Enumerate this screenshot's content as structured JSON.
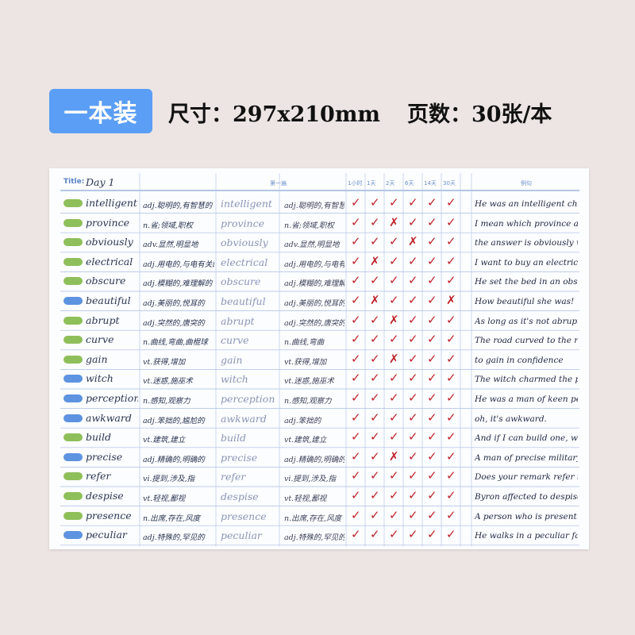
{
  "banner": {
    "badge": "一本装",
    "size": "尺寸：297x210mm",
    "pages": "页数：30张/本"
  },
  "sheet": {
    "title_label": "Title:",
    "title_value": "Day 1",
    "header_first_pass": "第一遍",
    "review_columns": [
      "1小时",
      "1天",
      "2天",
      "6天",
      "14天",
      "30天"
    ],
    "header_example": "例句"
  },
  "colors": {
    "green_tag": "#8fbf5a",
    "blue_tag": "#5d93e0",
    "check": "#c0222a"
  },
  "rows": [
    {
      "tag": "green",
      "word": "intelligent",
      "meaning": "adj.聪明的,有智慧的",
      "word2": "intelligent",
      "meaning2": "adj.聪明的,有智慧的",
      "marks": [
        "v",
        "v",
        "v",
        "v",
        "v",
        "v"
      ],
      "example": "He was an intelligent child."
    },
    {
      "tag": "green",
      "word": "province",
      "meaning": "n.省;领域,职权",
      "word2": "province",
      "meaning2": "n.省;领域,职权",
      "marks": [
        "v",
        "v",
        "x",
        "v",
        "v",
        "v"
      ],
      "example": "I mean which province are you from"
    },
    {
      "tag": "green",
      "word": "obviously",
      "meaning": "adv.显然,明显地",
      "word2": "obviously",
      "meaning2": "adv.显然,明显地",
      "marks": [
        "v",
        "v",
        "v",
        "x",
        "v",
        "v"
      ],
      "example": "the answer is obviously wrong"
    },
    {
      "tag": "green",
      "word": "electrical",
      "meaning": "adj.用电的,与电有关的",
      "word2": "electrical",
      "meaning2": "adj.用电的,与电有关",
      "marks": [
        "v",
        "x",
        "v",
        "v",
        "v",
        "v"
      ],
      "example": "I want to buy an electric car."
    },
    {
      "tag": "green",
      "word": "obscure",
      "meaning": "adj.模糊的,难理解的",
      "word2": "obscure",
      "meaning2": "adj.模糊的,难理解的",
      "marks": [
        "v",
        "v",
        "v",
        "v",
        "v",
        "v"
      ],
      "example": "He set the bed in an obscure corner"
    },
    {
      "tag": "blue",
      "word": "beautiful",
      "meaning": "adj.美丽的,悦耳的",
      "word2": "beautiful",
      "meaning2": "adj.美丽的,悦耳的",
      "marks": [
        "v",
        "x",
        "v",
        "v",
        "v",
        "x"
      ],
      "example": "How beautiful she was!"
    },
    {
      "tag": "green",
      "word": "abrupt",
      "meaning": "adj.突然的,唐突的",
      "word2": "abrupt",
      "meaning2": "adj.突然的,唐突的",
      "marks": [
        "v",
        "v",
        "x",
        "v",
        "v",
        "v"
      ],
      "example": "As long as it's not abrupt."
    },
    {
      "tag": "green",
      "word": "curve",
      "meaning": "n.曲线,弯曲,曲棍球",
      "word2": "curve",
      "meaning2": "n.曲线,弯曲",
      "marks": [
        "v",
        "v",
        "v",
        "v",
        "v",
        "v"
      ],
      "example": "The road curved to the right."
    },
    {
      "tag": "green",
      "word": "gain",
      "meaning": "vt.获得,增加",
      "word2": "gain",
      "meaning2": "vt.获得,增加",
      "marks": [
        "v",
        "v",
        "x",
        "v",
        "v",
        "v"
      ],
      "example": "to gain in confidence"
    },
    {
      "tag": "blue",
      "word": "witch",
      "meaning": "vt.迷惑,施巫术",
      "word2": "witch",
      "meaning2": "vt.迷惑,施巫术",
      "marks": [
        "v",
        "v",
        "v",
        "v",
        "v",
        "v"
      ],
      "example": "The witch charmed the prince"
    },
    {
      "tag": "blue",
      "word": "perception",
      "meaning": "n.感知,观察力",
      "word2": "perception",
      "meaning2": "n.感知,观察力",
      "marks": [
        "v",
        "v",
        "v",
        "v",
        "v",
        "v"
      ],
      "example": "He was a man of keen perception"
    },
    {
      "tag": "blue",
      "word": "awkward",
      "meaning": "adj.笨拙的,尴尬的",
      "word2": "awkward",
      "meaning2": "adj.笨拙的",
      "marks": [
        "v",
        "v",
        "v",
        "v",
        "v",
        "v"
      ],
      "example": "oh, it's awkward."
    },
    {
      "tag": "green",
      "word": "build",
      "meaning": "vt.建筑,建立",
      "word2": "build",
      "meaning2": "vt.建筑,建立",
      "marks": [
        "v",
        "v",
        "v",
        "v",
        "v",
        "v"
      ],
      "example": "And if I can build one, well."
    },
    {
      "tag": "blue",
      "word": "precise",
      "meaning": "adj.精确的,明确的",
      "word2": "precise",
      "meaning2": "adj.精确的,明确的",
      "marks": [
        "v",
        "v",
        "x",
        "v",
        "v",
        "v"
      ],
      "example": "A man of precise military bearing"
    },
    {
      "tag": "green",
      "word": "refer",
      "meaning": "vi.提到,涉及,指",
      "word2": "refer",
      "meaning2": "vi.提到,涉及,指",
      "marks": [
        "v",
        "v",
        "v",
        "v",
        "v",
        "v"
      ],
      "example": "Does your remark refer to all of us?"
    },
    {
      "tag": "green",
      "word": "despise",
      "meaning": "vt.轻视,鄙视",
      "word2": "despise",
      "meaning2": "vt.轻视,鄙视",
      "marks": [
        "v",
        "v",
        "v",
        "v",
        "v",
        "v"
      ],
      "example": "Byron affected to despise posterity"
    },
    {
      "tag": "green",
      "word": "presence",
      "meaning": "n.出席,存在,风度",
      "word2": "presence",
      "meaning2": "n.出席,存在,风度",
      "marks": [
        "v",
        "v",
        "v",
        "v",
        "v",
        "v"
      ],
      "example": "A person who is present."
    },
    {
      "tag": "blue",
      "word": "peculiar",
      "meaning": "adj.特殊的,罕见的",
      "word2": "peculiar",
      "meaning2": "adj.特殊的,罕见的",
      "marks": [
        "v",
        "v",
        "v",
        "v",
        "v",
        "v"
      ],
      "example": "He walks in a peculiar fashion."
    }
  ]
}
